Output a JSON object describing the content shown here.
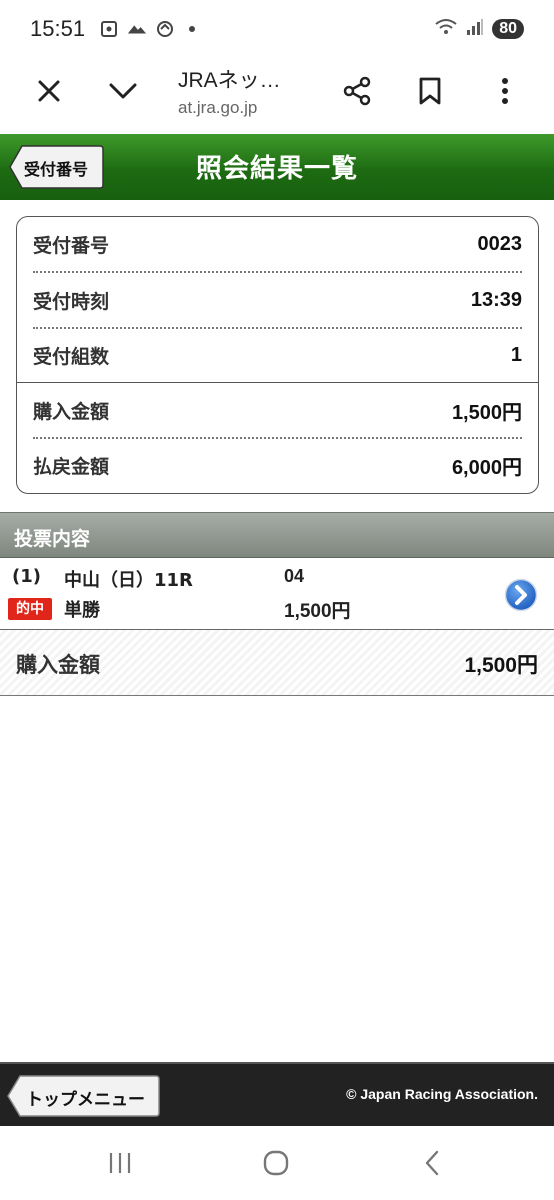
{
  "status_bar": {
    "time": "15:51",
    "battery": "80"
  },
  "browser": {
    "title": "JRAネッ…",
    "url": "at.jra.go.jp"
  },
  "header": {
    "back_label": "受付番号",
    "title": "照会結果一覧"
  },
  "receipt": {
    "rows": [
      {
        "label": "受付番号",
        "value": "0023"
      },
      {
        "label": "受付時刻",
        "value": "13:39"
      },
      {
        "label": "受付組数",
        "value": "1"
      },
      {
        "label": "購入金額",
        "value": "1,500円"
      },
      {
        "label": "払戻金額",
        "value": "6,000円"
      }
    ]
  },
  "votes": {
    "section_title": "投票内容",
    "items": [
      {
        "number": "(1)",
        "race": "中山（日）11R",
        "horse": "04",
        "badge": "的中",
        "bet_type": "単勝",
        "amount": "1,500円"
      }
    ],
    "total_label": "購入金額",
    "total_value": "1,500円"
  },
  "footer": {
    "top_menu_label": "トップメニュー",
    "copyright": "© Japan Racing Association."
  },
  "colors": {
    "header_green": "#1d6b12",
    "hit_badge_red": "#e0261a",
    "arrow_blue": "#2b6fd0",
    "footer_dark": "#222222"
  }
}
